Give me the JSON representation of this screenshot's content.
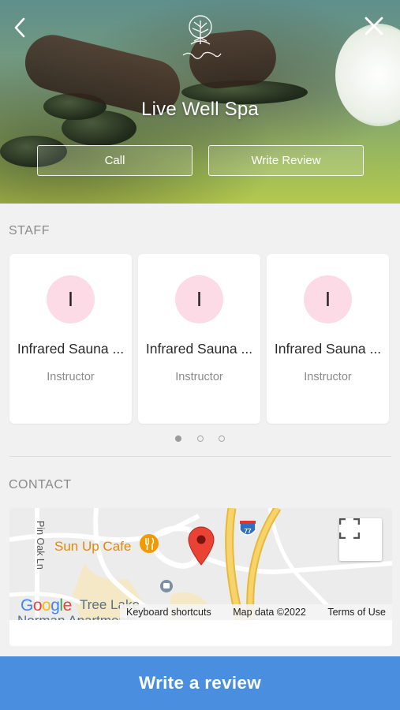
{
  "header": {
    "title": "Live Well Spa",
    "back_icon": "chevron-left-icon",
    "close_icon": "close-icon",
    "logo_text": "Live Well Spa",
    "call_label": "Call",
    "write_review_label": "Write Review"
  },
  "staff": {
    "section_label": "STAFF",
    "members": [
      {
        "initial": "I",
        "name": "Infrared Sauna ...",
        "role": "Instructor"
      },
      {
        "initial": "I",
        "name": "Infrared Sauna ...",
        "role": "Instructor"
      },
      {
        "initial": "I",
        "name": "Infrared Sauna ...",
        "role": "Instructor"
      }
    ],
    "pager": {
      "pages": 3,
      "active_index": 0
    }
  },
  "contact": {
    "section_label": "CONTACT",
    "map": {
      "poi": "Sun Up Cafe",
      "street": "Pin Oak Ln",
      "area": "Tree Lake",
      "area_cut": "Norman Apartments",
      "highway_shield": "77",
      "google_logo": "Google",
      "keyboard_shortcuts": "Keyboard shortcuts",
      "map_data": "Map data ©2022",
      "terms": "Terms of Use"
    }
  },
  "cta": {
    "label": "Write a review"
  },
  "colors": {
    "accent_blue": "#4a8fdf",
    "avatar_pink": "#fddbe6",
    "map_pin_red": "#ea4335",
    "poi_orange": "#e38a00",
    "highway_yellow": "#f2c94c"
  }
}
